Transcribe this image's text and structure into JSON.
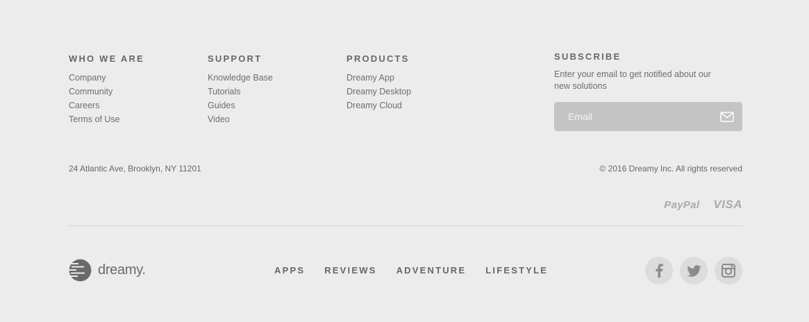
{
  "columns": [
    {
      "heading": "WHO WE ARE",
      "links": [
        "Company",
        "Community",
        "Careers",
        "Terms of Use"
      ]
    },
    {
      "heading": "SUPPORT",
      "links": [
        "Knowledge Base",
        "Tutorials",
        "Guides",
        "Video"
      ]
    },
    {
      "heading": "PRODUCTS",
      "links": [
        "Dreamy App",
        "Dreamy Desktop",
        "Dreamy Cloud"
      ]
    }
  ],
  "subscribe": {
    "heading": "SUBSCRIBE",
    "description": "Enter your email to get notified about our new solutions",
    "email_placeholder": "Email",
    "email_value": ""
  },
  "address": "24 Atlantic Ave, Brooklyn, NY 11201",
  "copyright": "© 2016 Dreamy Inc. All rights reserved",
  "payments": {
    "paypal": "PayPal",
    "visa": "VISA"
  },
  "brand": {
    "name": "dreamy."
  },
  "nav": [
    "APPS",
    "REVIEWS",
    "ADVENTURE",
    "LIFESTYLE"
  ],
  "social_icons": [
    "facebook-icon",
    "twitter-icon",
    "instagram-icon"
  ],
  "colors": {
    "background": "#ececec",
    "input_background": "#c4c4c4",
    "social_circle": "#dcdcdc",
    "text": "#666666",
    "icon": "#8a8a8a"
  }
}
